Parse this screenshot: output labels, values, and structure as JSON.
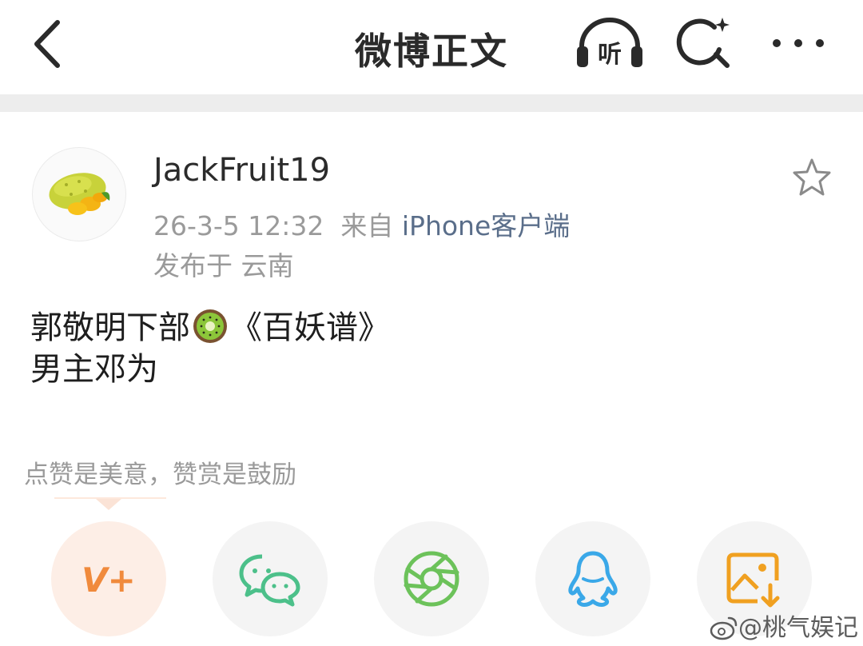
{
  "header": {
    "title": "微博正文",
    "listen_label": "听"
  },
  "post": {
    "username": "JackFruit19",
    "time": "26-3-5 12:32",
    "from_prefix": "来自",
    "source": "iPhone客户端",
    "location": "发布于 云南",
    "line1_before": "郭敬明下部",
    "line1_after": "《百妖谱》",
    "line2": "男主邓为"
  },
  "reward": {
    "text": "点赞是美意，赞赏是鼓励",
    "vip_label": "V+"
  },
  "watermark": {
    "text": "@桃气娱记"
  },
  "colors": {
    "vip": "#f08a3c",
    "wechat": "#4cc08a",
    "moments": "#6cc25a",
    "qq": "#3aa8e8",
    "save": "#f0a020"
  },
  "icons": [
    "back-arrow-icon",
    "headphones-icon",
    "search-icon",
    "more-icon",
    "star-icon",
    "kiwi-emoji-icon",
    "vip-plus-icon",
    "wechat-icon",
    "moments-icon",
    "qq-icon",
    "save-image-icon",
    "weibo-logo-icon"
  ]
}
